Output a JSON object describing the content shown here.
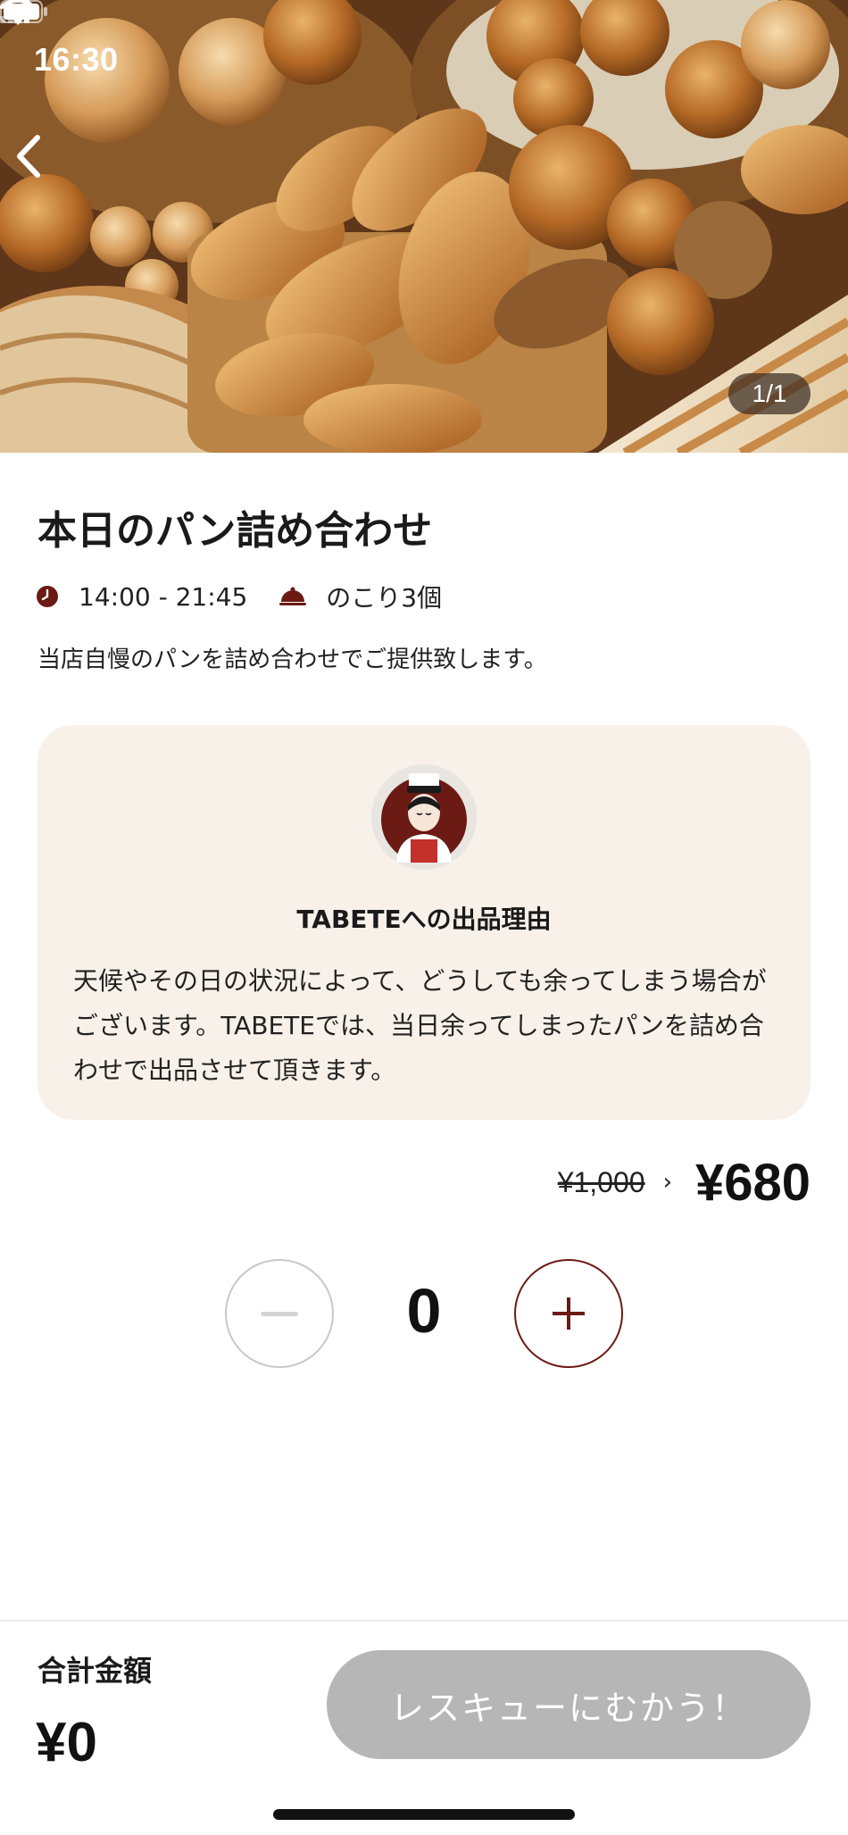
{
  "status_bar": {
    "time": "16:30",
    "icons": [
      "location-arrow-icon",
      "signal-icon",
      "wifi-icon",
      "battery-icon"
    ]
  },
  "hero": {
    "image_counter": "1/1",
    "back_icon": "chevron-left-icon"
  },
  "product": {
    "title": "本日のパン詰め合わせ",
    "time_range": "14:00 - 21:45",
    "remaining": "のこり3個",
    "description": "当店自慢のパンを詰め合わせでご提供致します。"
  },
  "reason": {
    "title": "TABETEへの出品理由",
    "body": "天候やその日の状況によって、どうしても余ってしまう場合がございます。TABETEでは、当日余ってしまったパンを詰め合わせで出品させて頂きます。"
  },
  "pricing": {
    "original_price": "¥1,000",
    "arrow": "›",
    "sale_price": "¥680"
  },
  "stepper": {
    "quantity": "0",
    "minus_label": "−",
    "plus_label": "+"
  },
  "footer": {
    "total_label": "合計金額",
    "total_value": "¥0",
    "rescue_button_label": "レスキューにむかう！"
  },
  "colors": {
    "accent": "#6b1a14",
    "card_background": "#f7f1e9",
    "disabled_button": "#b6b6b6"
  }
}
